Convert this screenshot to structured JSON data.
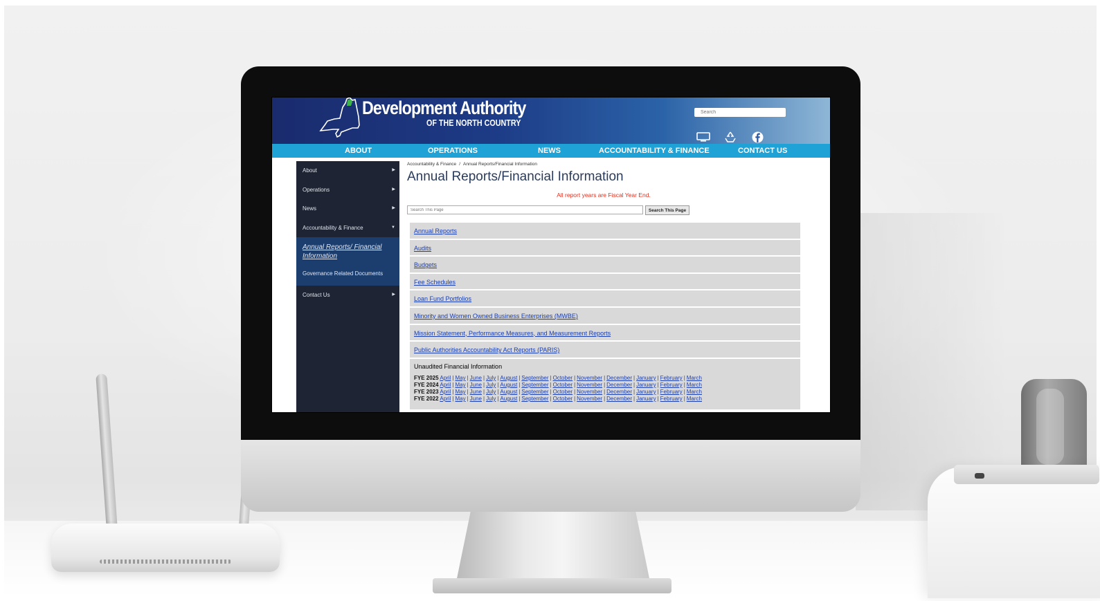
{
  "site": {
    "title_line1": "Development Authority",
    "title_line2": "OF THE NORTH COUNTRY",
    "search_placeholder": "Search"
  },
  "header_icons": [
    "monitor-icon",
    "recycle-icon",
    "facebook-icon"
  ],
  "nav": [
    "ABOUT",
    "OPERATIONS",
    "NEWS",
    "ACCOUNTABILITY & FINANCE",
    "CONTACT US"
  ],
  "sidebar": {
    "items": [
      {
        "label": "About",
        "arrow": "▶"
      },
      {
        "label": "Operations",
        "arrow": "▶"
      },
      {
        "label": "News",
        "arrow": "▶"
      },
      {
        "label": "Accountability & Finance",
        "arrow": "▼"
      }
    ],
    "sub_active": "Annual Reports/ Financial Information",
    "sub_item": "Governance Related Documents",
    "contact": {
      "label": "Contact Us",
      "arrow": "▶"
    }
  },
  "main": {
    "breadcrumb": [
      "Accountability & Finance",
      "/",
      "Annual Reports/Financial Information"
    ],
    "title": "Annual Reports/Financial Information",
    "notice": "All report years are Fiscal Year End.",
    "search_placeholder": "Search This Page",
    "search_button": "Search This Page",
    "sections": [
      "Annual Reports",
      "Audits",
      "Budgets",
      "Fee Schedules",
      "Loan Fund Portfolios",
      "Minority and Women Owned Business Enterprises (MWBE)",
      "Mission Statement, Performance Measures, and Measurement Reports",
      "Public Authorities Accountability Act Reports (PARIS)"
    ],
    "unaudited": {
      "title": "Unaudited Financial Information",
      "rows": [
        {
          "label": "FYE 2025",
          "months": [
            "April",
            "May",
            "June",
            "July",
            "August",
            "September",
            "October",
            "November",
            "December",
            "January",
            "February",
            "March"
          ]
        },
        {
          "label": "FYE 2024",
          "months": [
            "April",
            "May",
            "June",
            "July",
            "August",
            "September",
            "October",
            "November",
            "December",
            "January",
            "February",
            "March"
          ]
        },
        {
          "label": "FYE 2023",
          "months": [
            "April",
            "May",
            "June",
            "July",
            "August",
            "September",
            "October",
            "November",
            "December",
            "January",
            "February",
            "March"
          ]
        },
        {
          "label": "FYE 2022",
          "months": [
            "April",
            "May",
            "June",
            "July",
            "August",
            "September",
            "October",
            "November",
            "December",
            "January",
            "February",
            "March"
          ]
        }
      ]
    }
  }
}
